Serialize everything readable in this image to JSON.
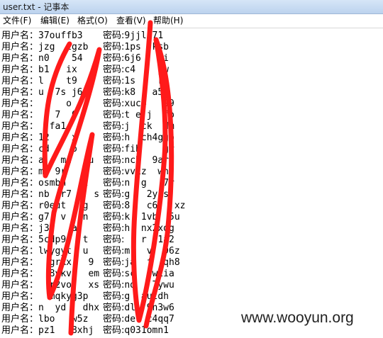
{
  "window": {
    "title": "user.txt - 记事本"
  },
  "menu": [
    {
      "label": "文件(F)"
    },
    {
      "label": "编辑(E)"
    },
    {
      "label": "格式(O)"
    },
    {
      "label": "查看(V)"
    },
    {
      "label": "帮助(H)"
    }
  ],
  "editor": {
    "user_label": "用户名：",
    "pass_label": "密码:",
    "rows": [
      {
        "user": "37ouffb3",
        "pass": "9jjl171"
      },
      {
        "user": "jzg  zgzb",
        "pass": "1ps  ksb"
      },
      {
        "user": "n0    54",
        "pass": "6j6   ki"
      },
      {
        "user": "b1   ix",
        "pass": "c4    jw"
      },
      {
        "user": "l    t9",
        "pass": "1s    rk"
      },
      {
        "user": "u  7s j6",
        "pass": "k8   a5h"
      },
      {
        "user": "     o",
        "pass": "xuc4   99"
      },
      {
        "user": "   7  0",
        "pass": "t e j  fp"
      },
      {
        "user": "  fa1",
        "pass": "j  ck  dm"
      },
      {
        "user": "12    x",
        "pass": "h  ch4ggb"
      },
      {
        "user": "cd    o",
        "pass": "fih    gr"
      },
      {
        "user": "a   me   u",
        "pass": "ncb  9ar"
      },
      {
        "user": "m5 9r   o",
        "pass": "vv1z  wn"
      },
      {
        "user": "osmbh   z",
        "pass": "n  g   7r"
      },
      {
        "user": "nb  r7    s",
        "pass": "g   2y1sj"
      },
      {
        "user": "r0eut   g",
        "pass": "8   c6   xz"
      },
      {
        "user": "g7  v   n",
        "pass": "k  1vb  5u"
      },
      {
        "user": "j3j   a",
        "pass": "h  nx2xqg"
      },
      {
        "user": "5cdp9   t",
        "pass": "   r  1a2"
      },
      {
        "user": "lwygyt  u",
        "pass": "m   v  96z"
      },
      {
        "user": "  grkx   9",
        "pass": "ja  f  qh8"
      },
      {
        "user": "  8vkv   em",
        "pass": "sc   w2ia"
      },
      {
        "user": "  r2vo   xs",
        "pass": "nd   7ywu"
      },
      {
        "user": "  mqkyg3p",
        "pass": "g  autdh"
      },
      {
        "user": "n  yd   dhx",
        "pass": "dl  9n3w6"
      },
      {
        "user": "lbo   w5z",
        "pass": "de  c4qq7"
      },
      {
        "user": "pz1   8xhj",
        "pass": "q031omn1"
      }
    ]
  },
  "watermark": {
    "text": "www.wooyun.org"
  },
  "colors": {
    "scribble": "#ff1a1a",
    "titlebar": "#c9dcf2"
  }
}
